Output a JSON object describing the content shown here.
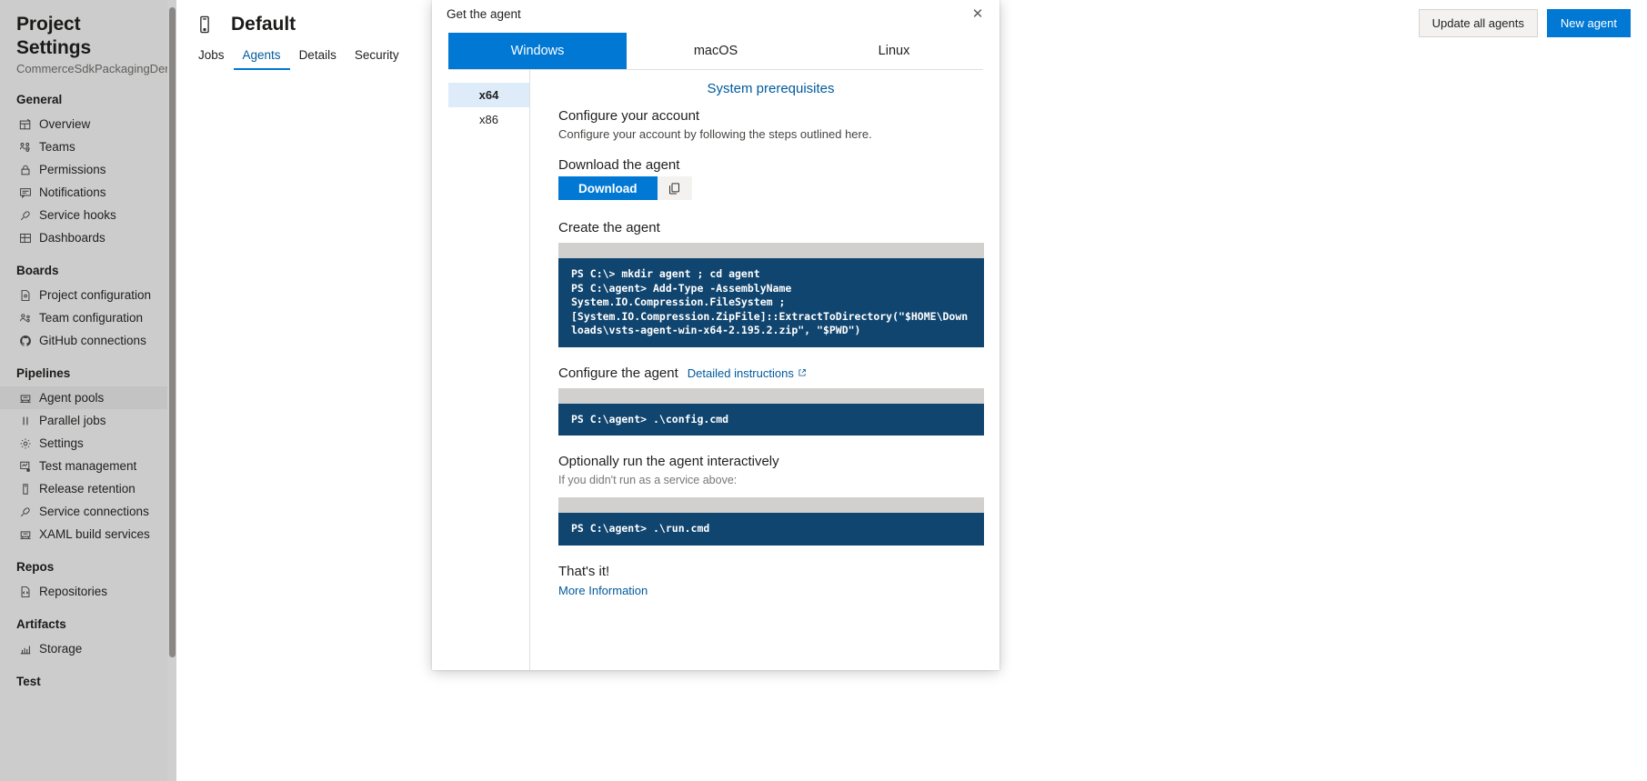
{
  "sidebar": {
    "title": "Project Settings",
    "subtitle": "CommerceSdkPackagingDemo",
    "groups": [
      {
        "title": "General",
        "items": [
          {
            "label": "Overview",
            "icon": "overview-icon"
          },
          {
            "label": "Teams",
            "icon": "teams-icon"
          },
          {
            "label": "Permissions",
            "icon": "lock-icon"
          },
          {
            "label": "Notifications",
            "icon": "notification-icon"
          },
          {
            "label": "Service hooks",
            "icon": "plug-icon"
          },
          {
            "label": "Dashboards",
            "icon": "dashboard-icon"
          }
        ]
      },
      {
        "title": "Boards",
        "items": [
          {
            "label": "Project configuration",
            "icon": "config-file-icon"
          },
          {
            "label": "Team configuration",
            "icon": "team-config-icon"
          },
          {
            "label": "GitHub connections",
            "icon": "github-icon"
          }
        ]
      },
      {
        "title": "Pipelines",
        "items": [
          {
            "label": "Agent pools",
            "icon": "agent-pool-icon"
          },
          {
            "label": "Parallel jobs",
            "icon": "parallel-jobs-icon"
          },
          {
            "label": "Settings",
            "icon": "gear-icon"
          },
          {
            "label": "Test management",
            "icon": "test-management-icon"
          },
          {
            "label": "Release retention",
            "icon": "release-retention-icon"
          },
          {
            "label": "Service connections",
            "icon": "plug-icon"
          },
          {
            "label": "XAML build services",
            "icon": "agent-pool-icon"
          }
        ]
      },
      {
        "title": "Repos",
        "items": [
          {
            "label": "Repositories",
            "icon": "repository-icon"
          }
        ]
      },
      {
        "title": "Artifacts",
        "items": [
          {
            "label": "Storage",
            "icon": "storage-chart-icon"
          }
        ]
      },
      {
        "title": "Test",
        "items": []
      }
    ],
    "selected_item": "Agent pools"
  },
  "main": {
    "pool_title": "Default",
    "pool_icon": "agent-pool-icon",
    "tabs": [
      {
        "label": "Jobs",
        "active": false
      },
      {
        "label": "Agents",
        "active": true
      },
      {
        "label": "Details",
        "active": false
      },
      {
        "label": "Security",
        "active": false
      }
    ],
    "actions": {
      "update_all_label": "Update all agents",
      "new_agent_label": "New agent"
    }
  },
  "dialog": {
    "title": "Get the agent",
    "close_icon": "close-icon",
    "os_tabs": [
      {
        "label": "Windows",
        "active": true
      },
      {
        "label": "macOS",
        "active": false
      },
      {
        "label": "Linux",
        "active": false
      }
    ],
    "architectures": [
      {
        "label": "x64",
        "selected": true
      },
      {
        "label": "x86",
        "selected": false
      }
    ],
    "prerequisites_link": "System prerequisites",
    "sections": {
      "configure_account": {
        "title": "Configure your account",
        "description": "Configure your account by following the steps outlined here."
      },
      "download": {
        "title": "Download the agent",
        "button_label": "Download",
        "copy_icon": "copy-icon"
      },
      "create": {
        "title": "Create the agent",
        "code": "PS C:\\> mkdir agent ; cd agent\nPS C:\\agent> Add-Type -AssemblyName System.IO.Compression.FileSystem ; [System.IO.Compression.ZipFile]::ExtractToDirectory(\"$HOME\\Downloads\\vsts-agent-win-x64-2.195.2.zip\", \"$PWD\")"
      },
      "configure_agent": {
        "title": "Configure the agent",
        "link_label": "Detailed instructions",
        "link_icon": "external-link-icon",
        "code": "PS C:\\agent> .\\config.cmd"
      },
      "run_interactively": {
        "title": "Optionally run the agent interactively",
        "note": "If you didn't run as a service above:",
        "code": "PS C:\\agent> .\\run.cmd"
      },
      "done": {
        "title": "That's it!",
        "more_info_label": "More Information"
      }
    }
  },
  "colors": {
    "accent": "#0078d4",
    "link": "#005a9e",
    "code_background": "#10456f",
    "sidebar_background": "#cccccc",
    "arch_selected": "#deecf9"
  }
}
